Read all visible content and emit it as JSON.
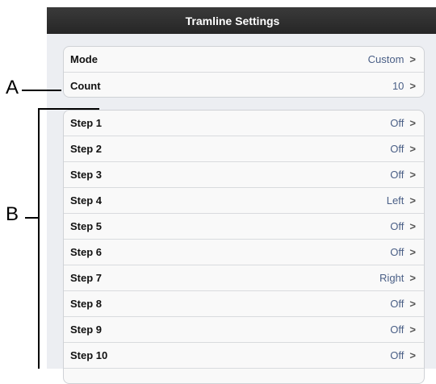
{
  "window": {
    "title": "Tramline Settings"
  },
  "group1": {
    "rows": [
      {
        "label": "Mode",
        "value": "Custom"
      },
      {
        "label": "Count",
        "value": "10"
      }
    ]
  },
  "group2": {
    "rows": [
      {
        "label": "Step 1",
        "value": "Off"
      },
      {
        "label": "Step 2",
        "value": "Off"
      },
      {
        "label": "Step 3",
        "value": "Off"
      },
      {
        "label": "Step 4",
        "value": "Left"
      },
      {
        "label": "Step 5",
        "value": "Off"
      },
      {
        "label": "Step 6",
        "value": "Off"
      },
      {
        "label": "Step 7",
        "value": "Right"
      },
      {
        "label": "Step 8",
        "value": "Off"
      },
      {
        "label": "Step 9",
        "value": "Off"
      },
      {
        "label": "Step 10",
        "value": "Off"
      }
    ]
  },
  "callouts": {
    "a": "A",
    "b": "B"
  },
  "icons": {
    "disclosure": "chevron-right-icon"
  },
  "colors": {
    "value_text": "#4a5f86",
    "titlebar": "#2f2f2f"
  }
}
